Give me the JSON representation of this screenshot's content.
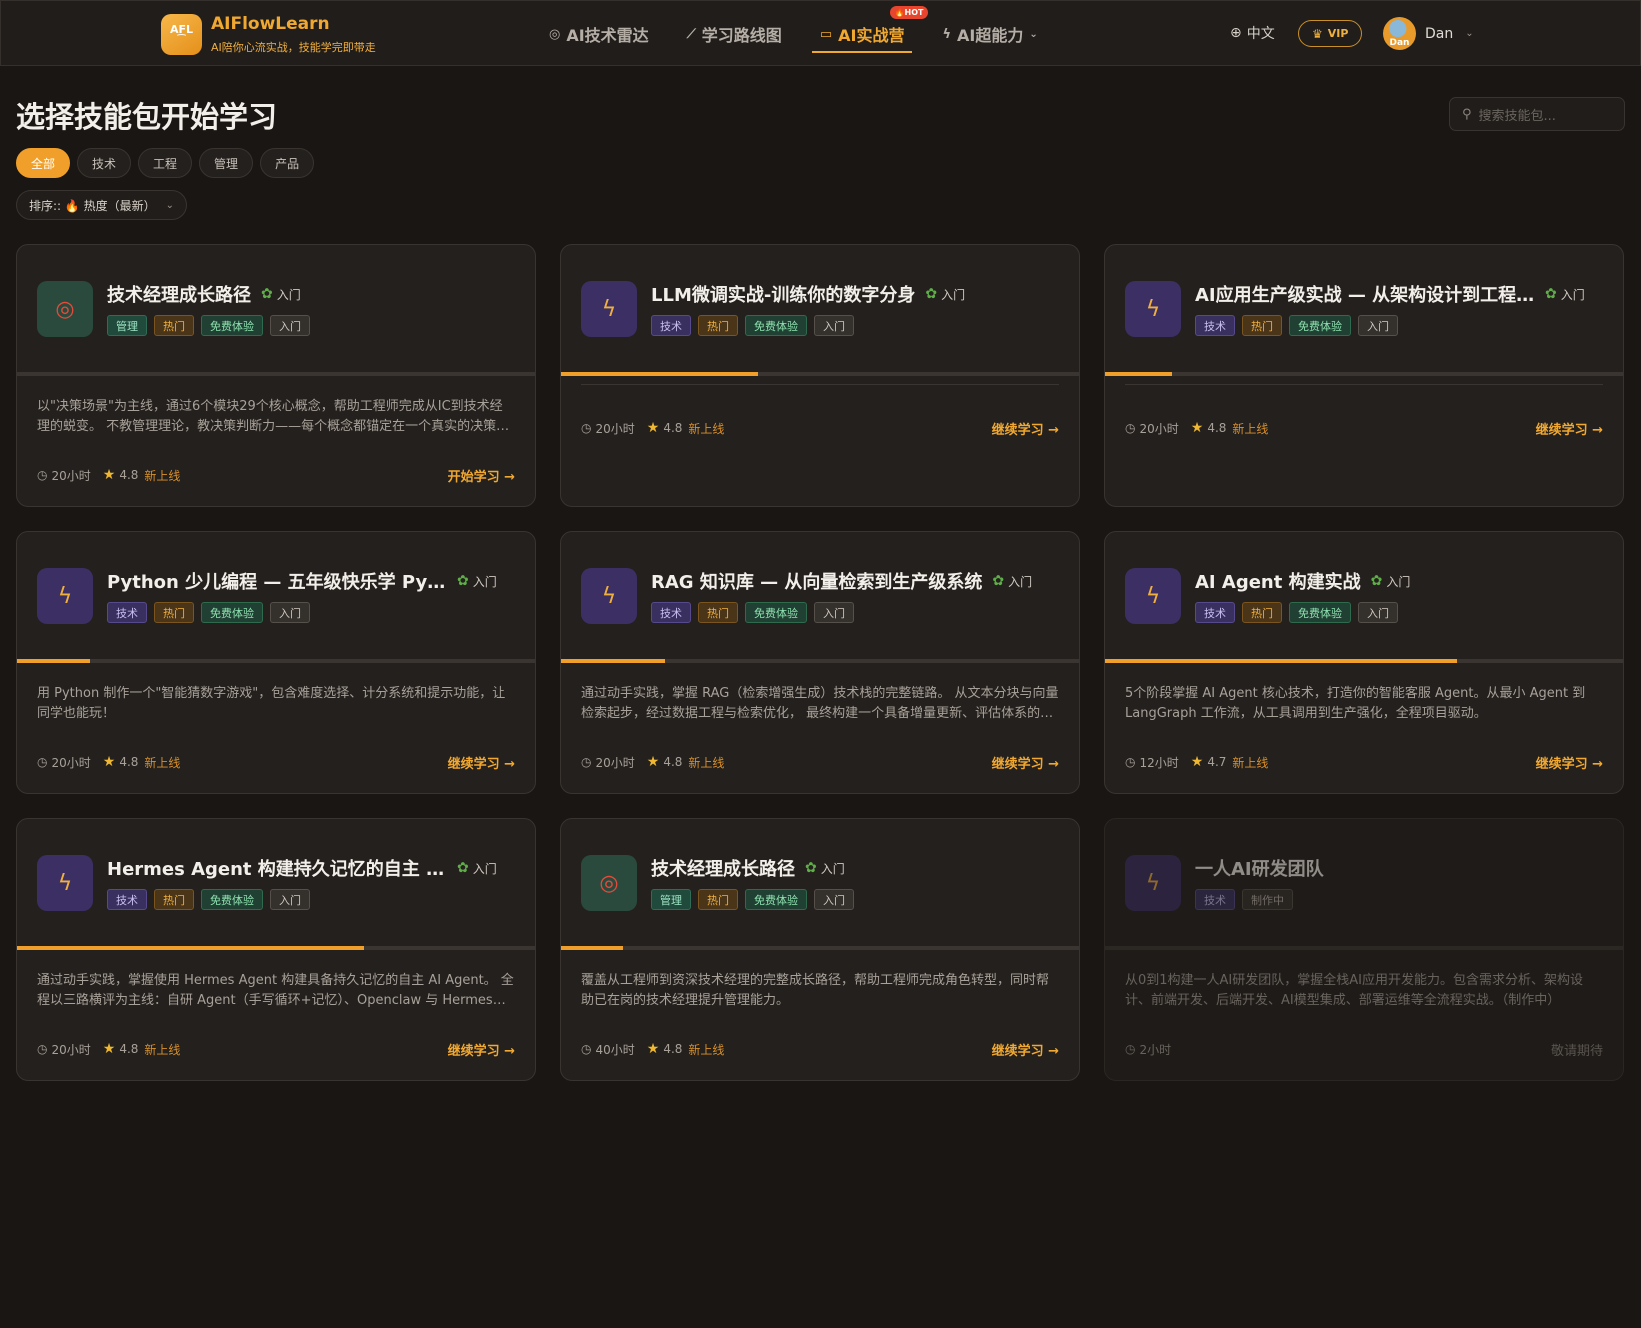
{
  "header": {
    "logo_text": "AFL",
    "brand_name": "AIFlowLearn",
    "slogan": "AI陪你心流实战，技能学完即带走",
    "nav": [
      {
        "label": "AI技术雷达",
        "icon": "radar-icon",
        "glyph": "◎"
      },
      {
        "label": "学习路线图",
        "icon": "trend-icon",
        "glyph": "⟋"
      },
      {
        "label": "AI实战营",
        "icon": "camp-icon",
        "glyph": "▭",
        "badge": "🔥HOT"
      },
      {
        "label": "AI超能力",
        "icon": "bolt-icon",
        "glyph": "ϟ"
      }
    ],
    "language": "中文",
    "vip": "VIP",
    "user": {
      "name": "Dan",
      "avatar_text": "Dan"
    }
  },
  "page": {
    "title": "选择技能包开始学习",
    "search_placeholder": "搜索技能包...",
    "filters": [
      "全部",
      "技术",
      "工程",
      "管理",
      "产品"
    ],
    "active_filter": "全部",
    "sort_label": "排序:: 🔥 热度（最新）"
  },
  "labels": {
    "level": "入门",
    "rating_new": "新上线"
  },
  "cards": [
    {
      "title": "技术经理成长路径",
      "icon": "target-icon",
      "icon_style": "green",
      "level": "入门",
      "tags": [
        {
          "label": "管理",
          "type": "mgmt"
        },
        {
          "label": "热门",
          "type": "hot"
        },
        {
          "label": "免费体验",
          "type": "free"
        },
        {
          "label": "入门",
          "type": "level"
        }
      ],
      "progress": 0.0,
      "description": "以\"决策场景\"为主线，通过6个模块29个核心概念，帮助工程师完成从IC到技术经理的蜕变。 不教管理理论，教决策判断力——每个概念都锚定在一个真实的决策场景中。",
      "duration": "20小时",
      "rating": "4.8",
      "status": "新上线",
      "action": "开始学习 →"
    },
    {
      "title": "LLM微调实战-训练你的数字分身",
      "icon": "bolt-icon",
      "icon_style": "purple",
      "level": "入门",
      "tags": [
        {
          "label": "技术",
          "type": "tech"
        },
        {
          "label": "热门",
          "type": "hot"
        },
        {
          "label": "免费体验",
          "type": "free"
        },
        {
          "label": "入门",
          "type": "level"
        }
      ],
      "progress": 0.38,
      "description": "",
      "duration": "20小时",
      "rating": "4.8",
      "status": "新上线",
      "action": "继续学习 →"
    },
    {
      "title": "AI应用生产级实战 — 从架构设计到工程落地",
      "icon": "bolt-icon",
      "icon_style": "purple",
      "level": "入门",
      "tags": [
        {
          "label": "技术",
          "type": "tech"
        },
        {
          "label": "热门",
          "type": "hot"
        },
        {
          "label": "免费体验",
          "type": "free"
        },
        {
          "label": "入门",
          "type": "level"
        }
      ],
      "progress": 0.13,
      "description": "",
      "duration": "20小时",
      "rating": "4.8",
      "status": "新上线",
      "action": "继续学习 →"
    },
    {
      "title": "Python 少儿编程 — 五年级快乐学 Python",
      "icon": "bolt-icon",
      "icon_style": "purple",
      "level": "入门",
      "tags": [
        {
          "label": "技术",
          "type": "tech"
        },
        {
          "label": "热门",
          "type": "hot"
        },
        {
          "label": "免费体验",
          "type": "free"
        },
        {
          "label": "入门",
          "type": "level"
        }
      ],
      "progress": 0.14,
      "description": "用 Python 制作一个\"智能猜数字游戏\"，包含难度选择、计分系统和提示功能，让同学也能玩！",
      "duration": "20小时",
      "rating": "4.8",
      "status": "新上线",
      "action": "继续学习 →"
    },
    {
      "title": "RAG 知识库 — 从向量检索到生产级系统",
      "icon": "bolt-icon",
      "icon_style": "purple",
      "level": "入门",
      "tags": [
        {
          "label": "技术",
          "type": "tech"
        },
        {
          "label": "热门",
          "type": "hot"
        },
        {
          "label": "免费体验",
          "type": "free"
        },
        {
          "label": "入门",
          "type": "level"
        }
      ],
      "progress": 0.2,
      "description": "通过动手实践，掌握 RAG（检索增强生成）技术栈的完整链路。 从文本分块与向量检索起步，经过数据工程与检索优化， 最终构建一个具备增量更新、评估体系的生产级知识库系统。",
      "duration": "20小时",
      "rating": "4.8",
      "status": "新上线",
      "action": "继续学习 →"
    },
    {
      "title": "AI Agent 构建实战",
      "icon": "bolt-icon",
      "icon_style": "purple",
      "level": "入门",
      "tags": [
        {
          "label": "技术",
          "type": "tech"
        },
        {
          "label": "热门",
          "type": "hot"
        },
        {
          "label": "免费体验",
          "type": "free"
        },
        {
          "label": "入门",
          "type": "level"
        }
      ],
      "progress": 0.68,
      "description": "5个阶段掌握 AI Agent 核心技术，打造你的智能客服 Agent。从最小 Agent 到 LangGraph 工作流，从工具调用到生产强化，全程项目驱动。",
      "duration": "12小时",
      "rating": "4.7",
      "status": "新上线",
      "action": "继续学习 →"
    },
    {
      "title": "Hermes Agent 构建持久记忆的自主 AI Agent",
      "icon": "bolt-icon",
      "icon_style": "purple",
      "level": "入门",
      "tags": [
        {
          "label": "技术",
          "type": "tech"
        },
        {
          "label": "热门",
          "type": "hot"
        },
        {
          "label": "免费体验",
          "type": "free"
        },
        {
          "label": "入门",
          "type": "level"
        }
      ],
      "progress": 0.67,
      "description": "通过动手实践，掌握使用 Hermes Agent 构建具备持久记忆的自主 AI Agent。 全程以三路横评为主线：自研 Agent（手写循环+记忆）、Openclaw 与 Hermes Agent 对比。",
      "duration": "20小时",
      "rating": "4.8",
      "status": "新上线",
      "action": "继续学习 →"
    },
    {
      "title": "技术经理成长路径",
      "icon": "target-icon",
      "icon_style": "green",
      "level": "入门",
      "tags": [
        {
          "label": "管理",
          "type": "mgmt"
        },
        {
          "label": "热门",
          "type": "hot"
        },
        {
          "label": "免费体验",
          "type": "free"
        },
        {
          "label": "入门",
          "type": "level"
        }
      ],
      "progress": 0.12,
      "description": "覆盖从工程师到资深技术经理的完整成长路径，帮助工程师完成角色转型，同时帮助已在岗的技术经理提升管理能力。",
      "duration": "40小时",
      "rating": "4.8",
      "status": "新上线",
      "action": "继续学习 →"
    },
    {
      "title": "一人AI研发团队",
      "icon": "bolt-icon",
      "icon_style": "purple",
      "level": "",
      "tags": [
        {
          "label": "技术",
          "type": "tech"
        },
        {
          "label": "制作中",
          "type": "making"
        }
      ],
      "progress": 0.0,
      "description": "从0到1构建一人AI研发团队，掌握全栈AI应用开发能力。包含需求分析、架构设计、前端开发、后端开发、AI模型集成、部署运维等全流程实战。（制作中）",
      "duration": "2小时",
      "rating": "",
      "status": "",
      "action": "敬请期待",
      "disabled": true
    }
  ],
  "colors": {
    "accent": "#f0a830",
    "background": "#1a1613",
    "card": "#24201d",
    "hot": "#e8452e"
  }
}
